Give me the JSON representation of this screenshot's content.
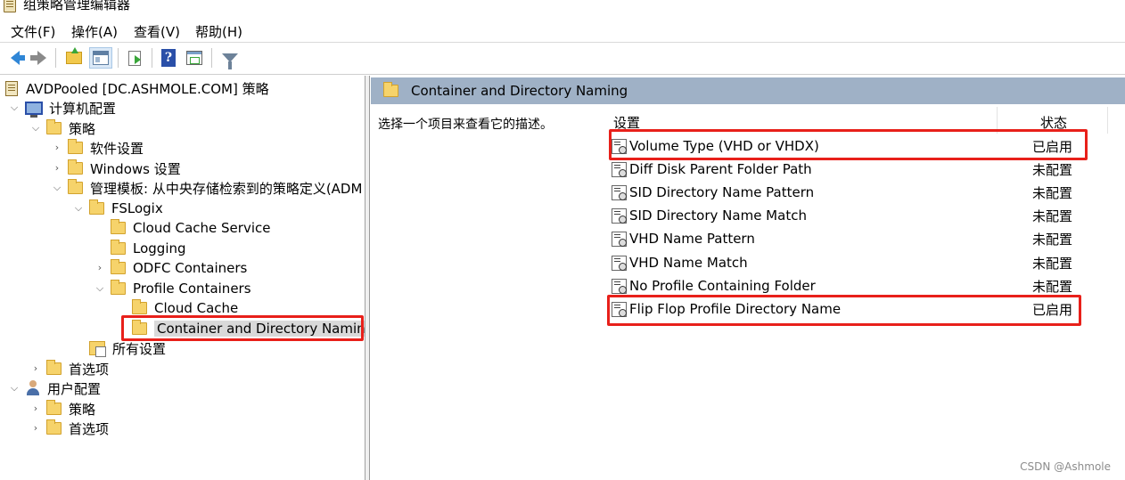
{
  "window": {
    "title": "组策略管理编辑器"
  },
  "menu": {
    "items": [
      "文件(F)",
      "操作(A)",
      "查看(V)",
      "帮助(H)"
    ]
  },
  "toolbar": {
    "buttons": [
      "back-icon",
      "forward-icon",
      "up-folder-icon",
      "show-hide-tree-icon",
      "export-list-icon",
      "help-icon",
      "view-icon",
      "filter-icon"
    ]
  },
  "tree": {
    "root": "AVDPooled [DC.ASHMOLE.COM] 策略",
    "computer_config": "计算机配置",
    "policies": "策略",
    "software_settings": "软件设置",
    "windows_settings": "Windows 设置",
    "admin_templates": "管理模板: 从中央存储检索到的策略定义(ADM",
    "fslogix": "FSLogix",
    "cloud_cache_service": "Cloud Cache Service",
    "logging": "Logging",
    "odfc_containers": "ODFC Containers",
    "profile_containers": "Profile Containers",
    "cloud_cache": "Cloud Cache",
    "container_naming": "Container and Directory Naming",
    "all_settings": "所有设置",
    "preferences": "首选项",
    "user_config": "用户配置",
    "user_policies": "策略",
    "user_preferences": "首选项"
  },
  "details": {
    "header_title": "Container and Directory Naming",
    "description": "选择一个项目来查看它的描述。",
    "col_setting": "设置",
    "col_status": "状态",
    "rows": [
      {
        "name": "Volume Type (VHD or VHDX)",
        "status": "已启用"
      },
      {
        "name": "Diff Disk Parent Folder Path",
        "status": "未配置"
      },
      {
        "name": "SID Directory Name Pattern",
        "status": "未配置"
      },
      {
        "name": "SID Directory Name Match",
        "status": "未配置"
      },
      {
        "name": "VHD Name Pattern",
        "status": "未配置"
      },
      {
        "name": "VHD Name Match",
        "status": "未配置"
      },
      {
        "name": "No Profile Containing Folder",
        "status": "未配置"
      },
      {
        "name": "Flip Flop Profile Directory Name",
        "status": "已启用"
      }
    ]
  },
  "watermark": "CSDN @Ashmole",
  "colors": {
    "highlight_box": "#e8201a",
    "header_bar": "#9fb1c6",
    "selected_bg": "#d9d9d9"
  }
}
